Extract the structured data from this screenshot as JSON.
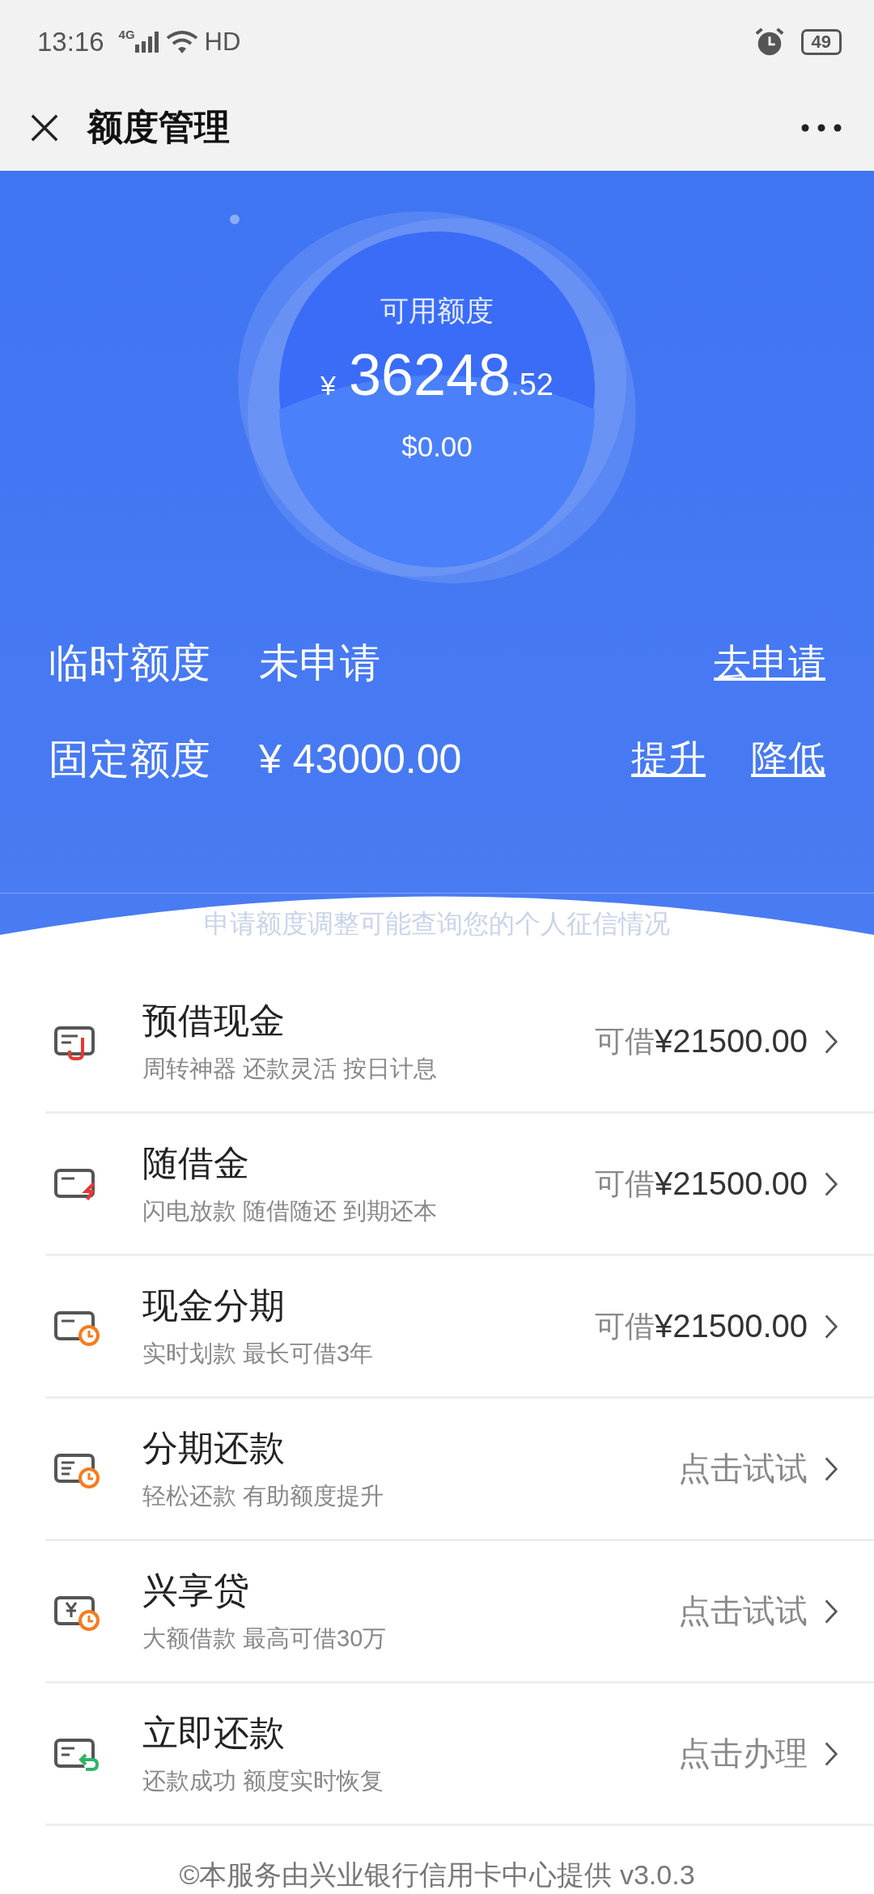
{
  "status_bar": {
    "time": "13:16",
    "network": "4G",
    "hd": "HD",
    "battery": "49"
  },
  "header": {
    "title": "额度管理"
  },
  "balance": {
    "label": "可用额度",
    "currency": "¥",
    "integer": "36248",
    "decimal": ".52",
    "usd": "$0.00"
  },
  "limits": [
    {
      "label": "临时额度",
      "value": "未申请",
      "actions": [
        "去申请"
      ]
    },
    {
      "label": "固定额度",
      "value": "¥ 43000.00",
      "actions": [
        "提升",
        "降低"
      ]
    }
  ],
  "notice": "申请额度调整可能查询您的个人征信情况",
  "items": [
    {
      "kind": "link",
      "title": "预借现金",
      "subtitle": "周转神器 还款灵活 按日计息",
      "note": "可借",
      "amount": "¥21500.00"
    },
    {
      "kind": "bolt",
      "title": "随借金",
      "subtitle": "闪电放款 随借随还 到期还本",
      "note": "可借",
      "amount": "¥21500.00"
    },
    {
      "kind": "clock",
      "title": "现金分期",
      "subtitle": "实时划款 最长可借3年",
      "note": "可借",
      "amount": "¥21500.00"
    },
    {
      "kind": "list-clock",
      "title": "分期还款",
      "subtitle": "轻松还款 有助额度提升",
      "action": "点击试试"
    },
    {
      "kind": "yen-clock",
      "title": "兴享贷",
      "subtitle": "大额借款 最高可借30万",
      "action": "点击试试"
    },
    {
      "kind": "return",
      "title": "立即还款",
      "subtitle": "还款成功 额度实时恢复",
      "action": "点击办理"
    }
  ],
  "footer": "©本服务由兴业银行信用卡中心提供 v3.0.3"
}
